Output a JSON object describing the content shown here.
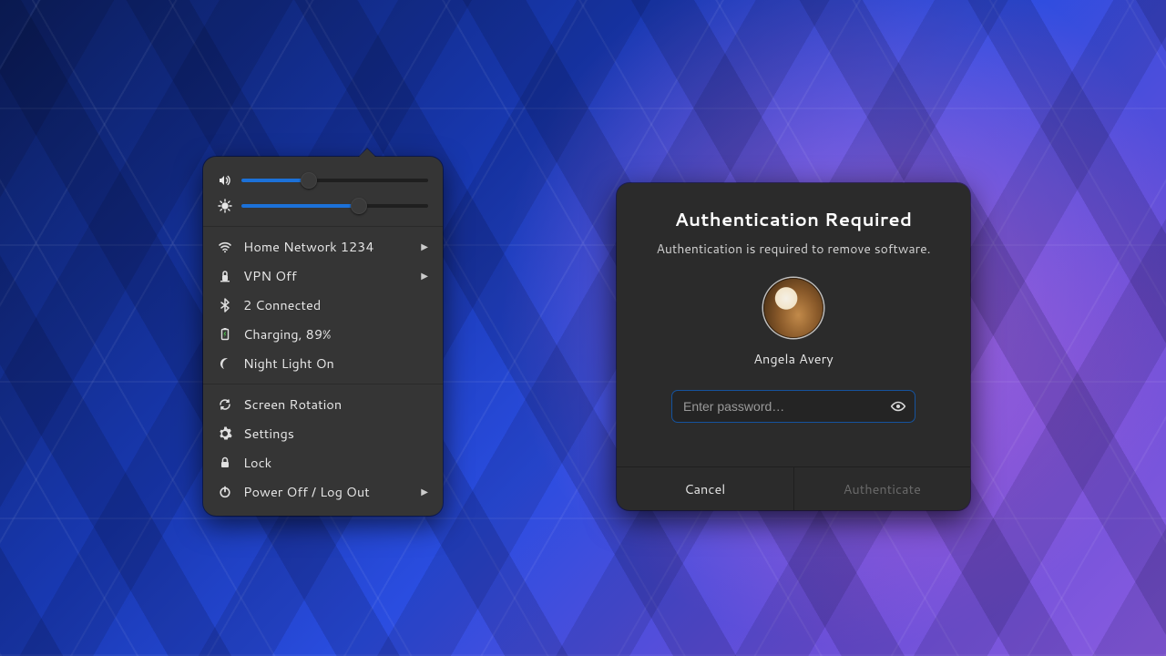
{
  "colors": {
    "accent": "#1c71d8"
  },
  "system_menu": {
    "sliders": {
      "volume": {
        "icon": "volume-icon",
        "percent": 36
      },
      "brightness": {
        "icon": "brightness-icon",
        "percent": 63
      }
    },
    "items": [
      {
        "icon": "wifi-icon",
        "label": "Home Network 1234",
        "submenu": true
      },
      {
        "icon": "vpn-icon",
        "label": "VPN Off",
        "submenu": true
      },
      {
        "icon": "bluetooth-icon",
        "label": "2 Connected",
        "submenu": false
      },
      {
        "icon": "battery-icon",
        "label": "Charging, 89%",
        "submenu": false
      },
      {
        "icon": "night-light-icon",
        "label": "Night Light On",
        "submenu": false
      }
    ],
    "items2": [
      {
        "icon": "rotation-icon",
        "label": "Screen Rotation",
        "submenu": false
      },
      {
        "icon": "settings-icon",
        "label": "Settings",
        "submenu": false
      },
      {
        "icon": "lock-icon",
        "label": "Lock",
        "submenu": false
      },
      {
        "icon": "power-icon",
        "label": "Power Off / Log Out",
        "submenu": true
      }
    ]
  },
  "auth_dialog": {
    "title": "Authentication Required",
    "subtitle": "Authentication is required to remove software.",
    "user_name": "Angela Avery",
    "password_placeholder": "Enter password…",
    "cancel_label": "Cancel",
    "confirm_label": "Authenticate",
    "confirm_enabled": false
  }
}
